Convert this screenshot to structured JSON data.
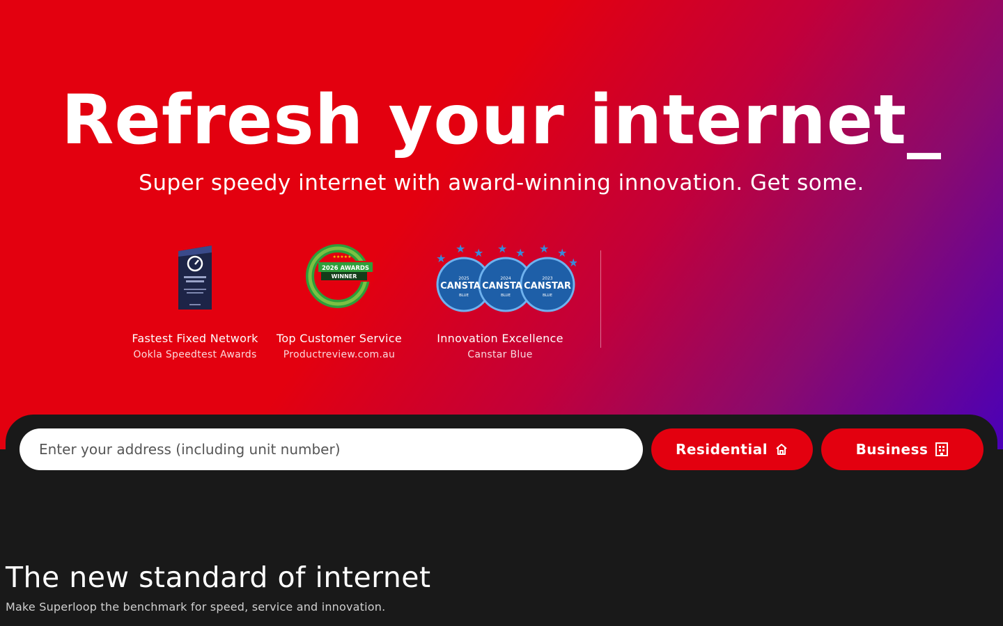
{
  "hero": {
    "title": "Refresh your internet_",
    "subtitle": "Super speedy internet with award-winning innovation. Get some."
  },
  "awards": [
    {
      "icon": "speedtest-award-icon",
      "title": "Fastest Fixed Network",
      "source": "Ookla Speedtest Awards"
    },
    {
      "icon": "productreview-award-icon",
      "title": "Top Customer Service",
      "source": "Productreview.com.au"
    },
    {
      "icon": "canstar-awards-icon",
      "title": "Innovation Excellence",
      "source": "Canstar Blue"
    }
  ],
  "search": {
    "placeholder": "Enter your address (including unit number)",
    "residential_label": "Residential",
    "residential_icon": "home-icon",
    "business_label": "Business",
    "business_icon": "building-icon"
  },
  "section": {
    "title": "The new standard of internet",
    "subtitle": "Make Superloop the benchmark for speed, service and innovation."
  },
  "colors": {
    "brand_red": "#e3000f",
    "gradient_purple": "#4a00b8",
    "dark_bg": "#191919"
  }
}
